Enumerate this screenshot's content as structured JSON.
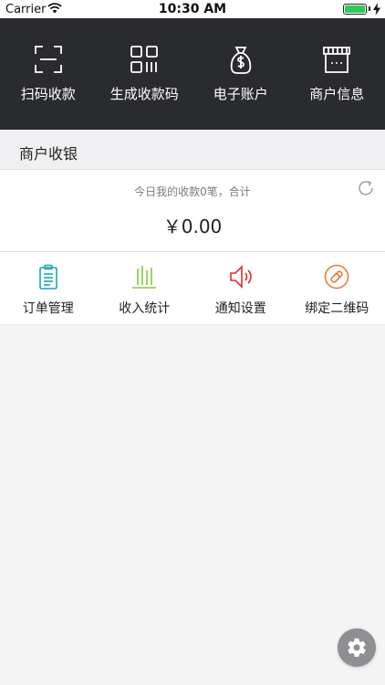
{
  "status_bar": {
    "carrier": "Carrier",
    "time": "10:30 AM"
  },
  "top_bar": {
    "items": [
      {
        "label": "扫码收款",
        "icon": "scan-icon"
      },
      {
        "label": "生成收款码",
        "icon": "qr-code-icon"
      },
      {
        "label": "电子账户",
        "icon": "money-bag-icon"
      },
      {
        "label": "商户信息",
        "icon": "store-icon"
      }
    ]
  },
  "section": {
    "title": "商户收银"
  },
  "summary": {
    "text": "今日我的收款0笔，合计",
    "amount": "￥0.00"
  },
  "functions": {
    "items": [
      {
        "label": "订单管理",
        "icon": "clipboard-icon",
        "color": "#1aa6b5"
      },
      {
        "label": "收入统计",
        "icon": "bar-stats-icon",
        "color": "#8cc63f"
      },
      {
        "label": "通知设置",
        "icon": "speaker-icon",
        "color": "#d9312b"
      },
      {
        "label": "绑定二维码",
        "icon": "link-icon",
        "color": "#ee7a3b"
      }
    ]
  },
  "colors": {
    "top_bar_bg": "#2a2b2f",
    "page_bg": "#f4f4f5",
    "fab_bg": "#8e8e93"
  }
}
